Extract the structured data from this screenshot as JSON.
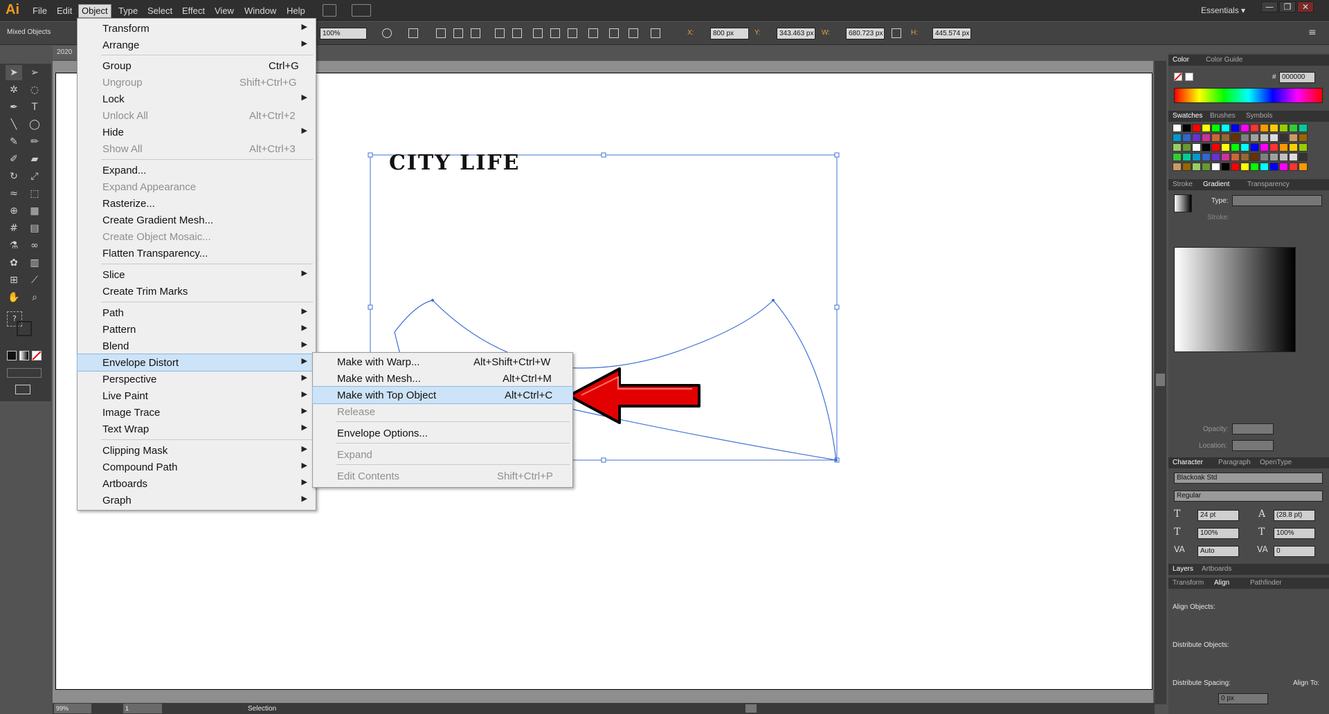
{
  "app": {
    "logo": "Ai",
    "workspace": "Essentials",
    "window_buttons": [
      "—",
      "❐",
      "✕"
    ]
  },
  "menubar": {
    "items": [
      "File",
      "Edit",
      "Object",
      "Type",
      "Select",
      "Effect",
      "View",
      "Window",
      "Help"
    ],
    "active": "Object"
  },
  "controlbar": {
    "selection_type": "Mixed Objects",
    "opacity": "100%",
    "x_label": "X:",
    "x": "800 px",
    "y_label": "Y:",
    "y": "343.463 px",
    "w_label": "W:",
    "w": "680.723 px",
    "h_label": "H:",
    "h": "445.574 px"
  },
  "doc_tab": "2020",
  "artwork": {
    "headline": "CITY LIFE"
  },
  "object_menu": {
    "items": [
      {
        "label": "Transform",
        "shortcut": "",
        "submenu": true,
        "disabled": false
      },
      {
        "label": "Arrange",
        "shortcut": "",
        "submenu": true,
        "disabled": false
      },
      {
        "label": "Group",
        "shortcut": "Ctrl+G",
        "submenu": false,
        "disabled": false
      },
      {
        "label": "Ungroup",
        "shortcut": "Shift+Ctrl+G",
        "submenu": false,
        "disabled": true
      },
      {
        "label": "Lock",
        "shortcut": "",
        "submenu": true,
        "disabled": false
      },
      {
        "label": "Unlock All",
        "shortcut": "Alt+Ctrl+2",
        "submenu": false,
        "disabled": true
      },
      {
        "label": "Hide",
        "shortcut": "",
        "submenu": true,
        "disabled": false
      },
      {
        "label": "Show All",
        "shortcut": "Alt+Ctrl+3",
        "submenu": false,
        "disabled": true
      },
      {
        "label": "Expand...",
        "shortcut": "",
        "submenu": false,
        "disabled": false
      },
      {
        "label": "Expand Appearance",
        "shortcut": "",
        "submenu": false,
        "disabled": true
      },
      {
        "label": "Rasterize...",
        "shortcut": "",
        "submenu": false,
        "disabled": false
      },
      {
        "label": "Create Gradient Mesh...",
        "shortcut": "",
        "submenu": false,
        "disabled": false
      },
      {
        "label": "Create Object Mosaic...",
        "shortcut": "",
        "submenu": false,
        "disabled": true
      },
      {
        "label": "Flatten Transparency...",
        "shortcut": "",
        "submenu": false,
        "disabled": false
      },
      {
        "label": "Slice",
        "shortcut": "",
        "submenu": true,
        "disabled": false
      },
      {
        "label": "Create Trim Marks",
        "shortcut": "",
        "submenu": false,
        "disabled": false
      },
      {
        "label": "Path",
        "shortcut": "",
        "submenu": true,
        "disabled": false
      },
      {
        "label": "Pattern",
        "shortcut": "",
        "submenu": true,
        "disabled": false
      },
      {
        "label": "Blend",
        "shortcut": "",
        "submenu": true,
        "disabled": false
      },
      {
        "label": "Envelope Distort",
        "shortcut": "",
        "submenu": true,
        "disabled": false,
        "highlighted": true
      },
      {
        "label": "Perspective",
        "shortcut": "",
        "submenu": true,
        "disabled": false
      },
      {
        "label": "Live Paint",
        "shortcut": "",
        "submenu": true,
        "disabled": false
      },
      {
        "label": "Image Trace",
        "shortcut": "",
        "submenu": true,
        "disabled": false
      },
      {
        "label": "Text Wrap",
        "shortcut": "",
        "submenu": true,
        "disabled": false
      },
      {
        "label": "Clipping Mask",
        "shortcut": "",
        "submenu": true,
        "disabled": false
      },
      {
        "label": "Compound Path",
        "shortcut": "",
        "submenu": true,
        "disabled": false
      },
      {
        "label": "Artboards",
        "shortcut": "",
        "submenu": true,
        "disabled": false
      },
      {
        "label": "Graph",
        "shortcut": "",
        "submenu": true,
        "disabled": false
      }
    ]
  },
  "envelope_submenu": {
    "items": [
      {
        "label": "Make with Warp...",
        "shortcut": "Alt+Shift+Ctrl+W",
        "disabled": false
      },
      {
        "label": "Make with Mesh...",
        "shortcut": "Alt+Ctrl+M",
        "disabled": false
      },
      {
        "label": "Make with Top Object",
        "shortcut": "Alt+Ctrl+C",
        "disabled": false,
        "highlighted": true
      },
      {
        "label": "Release",
        "shortcut": "",
        "disabled": true
      },
      {
        "label": "Envelope Options...",
        "shortcut": "",
        "disabled": false
      },
      {
        "label": "Expand",
        "shortcut": "",
        "disabled": true
      },
      {
        "label": "Edit Contents",
        "shortcut": "Shift+Ctrl+P",
        "disabled": true
      }
    ]
  },
  "panels": {
    "color": {
      "tabs": [
        "Color",
        "Color Guide"
      ],
      "hex_label": "#",
      "hex": "000000"
    },
    "swatches": {
      "tabs": [
        "Swatches",
        "Brushes",
        "Symbols"
      ]
    },
    "gradient": {
      "tabs": [
        "Stroke",
        "Gradient",
        "Transparency"
      ],
      "type_label": "Type:",
      "stroke_label": "Stroke:",
      "opacity_label": "Opacity:",
      "location_label": "Location:"
    },
    "character": {
      "tabs": [
        "Character",
        "Paragraph",
        "OpenType"
      ],
      "font": "Blackoak Std",
      "style": "Regular",
      "size": "24 pt",
      "leading": "(28.8 pt)",
      "v_scale": "100%",
      "h_scale": "100%",
      "kerning": "Auto",
      "tracking": "0"
    },
    "layers": {
      "tabs": [
        "Layers",
        "Artboards"
      ]
    },
    "align": {
      "tabs": [
        "Transform",
        "Align",
        "Pathfinder"
      ],
      "align_objects": "Align Objects:",
      "distribute_objects": "Distribute Objects:",
      "distribute_spacing": "Distribute Spacing:",
      "align_to": "Align To:",
      "spacing": "0 px"
    }
  },
  "statusbar": {
    "zoom": "99%",
    "artboard": "1",
    "mode": "Selection"
  },
  "colors": {
    "accent": "#f29a1b",
    "arrow_red": "#e30000",
    "selection_blue": "#3d6fd6"
  }
}
